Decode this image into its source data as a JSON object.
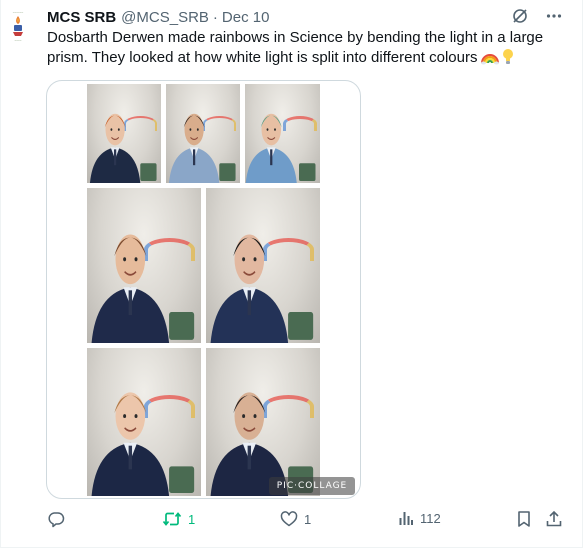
{
  "tweet": {
    "author_name": "MCS SRB",
    "author_handle": "@MCS_SRB",
    "separator": "·",
    "date": "Dec 10",
    "text": "Dosbarth Derwen made rainbows in Science by bending the light in a large prism. They looked at how white light is split into different colours",
    "emojis": [
      "rainbow-emoji",
      "light-bulb-emoji"
    ]
  },
  "media": {
    "watermark": "PIC·COLLAGE",
    "photos": [
      {
        "name": "photo-boy-red-hair",
        "skin": "#e9c2a6",
        "hair": "#c8622e",
        "top": "#1e2a44"
      },
      {
        "name": "photo-girl-glasses",
        "skin": "#d9ad8c",
        "hair": "#3a2b24",
        "top": "#8aa6c8"
      },
      {
        "name": "photo-child-headband",
        "skin": "#e7bfa3",
        "hair": "#5aa08a",
        "top": "#6f9cc9"
      },
      {
        "name": "photo-boy-headphones",
        "skin": "#e6bb9b",
        "hair": "#7a4a2e",
        "top": "#1f2a4a"
      },
      {
        "name": "photo-child-dark-hair",
        "skin": "#e2b8a0",
        "hair": "#1a1a1a",
        "top": "#233257"
      },
      {
        "name": "photo-boy-glasses",
        "skin": "#ecc6ab",
        "hair": "#b07a48",
        "top": "#1c2745"
      },
      {
        "name": "photo-girl-smiling",
        "skin": "#d8b094",
        "hair": "#2a2220",
        "top": "#1d2643"
      }
    ]
  },
  "actions": {
    "reply_count": "",
    "retweet_count": "1",
    "like_count": "1",
    "views_count": "112"
  },
  "colors": {
    "text": "#0f1419",
    "secondary": "#536471",
    "retweet_green": "#00ba7c",
    "border": "#cfd9de"
  },
  "icons": [
    "avatar-logo",
    "grok-icon",
    "more-icon",
    "reply-icon",
    "retweet-icon",
    "like-icon",
    "views-icon",
    "bookmark-icon",
    "share-icon"
  ]
}
